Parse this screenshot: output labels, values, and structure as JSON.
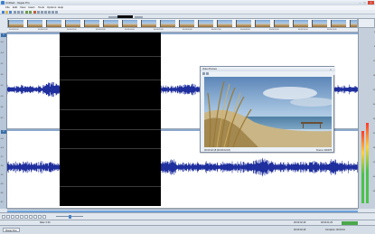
{
  "window": {
    "title": "Untitled - Vegas Pro",
    "controls": [
      "–",
      "□",
      "×"
    ]
  },
  "menu": [
    "File",
    "Edit",
    "View",
    "Insert",
    "Tools",
    "Options",
    "Help"
  ],
  "ruler": {
    "ticks": [
      "00:00:00;00",
      "00:00:01;00",
      "00:00:02;00",
      "00:00:03;00",
      "00:00:04;00",
      "00:00:05;00",
      "00:00:06;00",
      "00:00:07;00",
      "00:00:08;00",
      "00:00:09;00",
      "00:00:10;00",
      "00:00:11;00"
    ]
  },
  "tracks": [
    {
      "number": "1",
      "db_labels": [
        "-Inf",
        "-6.0",
        "-12",
        "-18",
        "-24",
        "-30",
        "-36",
        "-42"
      ]
    },
    {
      "number": "2",
      "db_labels": [
        "-Inf",
        "-6.0",
        "-12",
        "-18",
        "-24",
        "-30",
        "-36",
        "-42"
      ]
    }
  ],
  "meter": {
    "scale": [
      "0",
      "6",
      "12",
      "18",
      "24",
      "30",
      "36",
      "42",
      "48",
      "54",
      "60",
      "66"
    ],
    "levels": [
      0.42,
      0.47
    ]
  },
  "video_preview": {
    "title": "Video Preview",
    "info_left": "00:00:02;18 (00:00:02;18)",
    "info_right": "Frame: 000078"
  },
  "status": {
    "left": "Rate: 0.00",
    "time": "00:00:02;18",
    "end": "00:00:11;29"
  },
  "bottom": {
    "tab": "Master Bus",
    "time_code": "00:00:02;18",
    "complete": "Complete: 00:00:01"
  },
  "colors": {
    "waveform": "#1f2f9e",
    "selection": "#000000",
    "accent": "#3a6ea8"
  }
}
